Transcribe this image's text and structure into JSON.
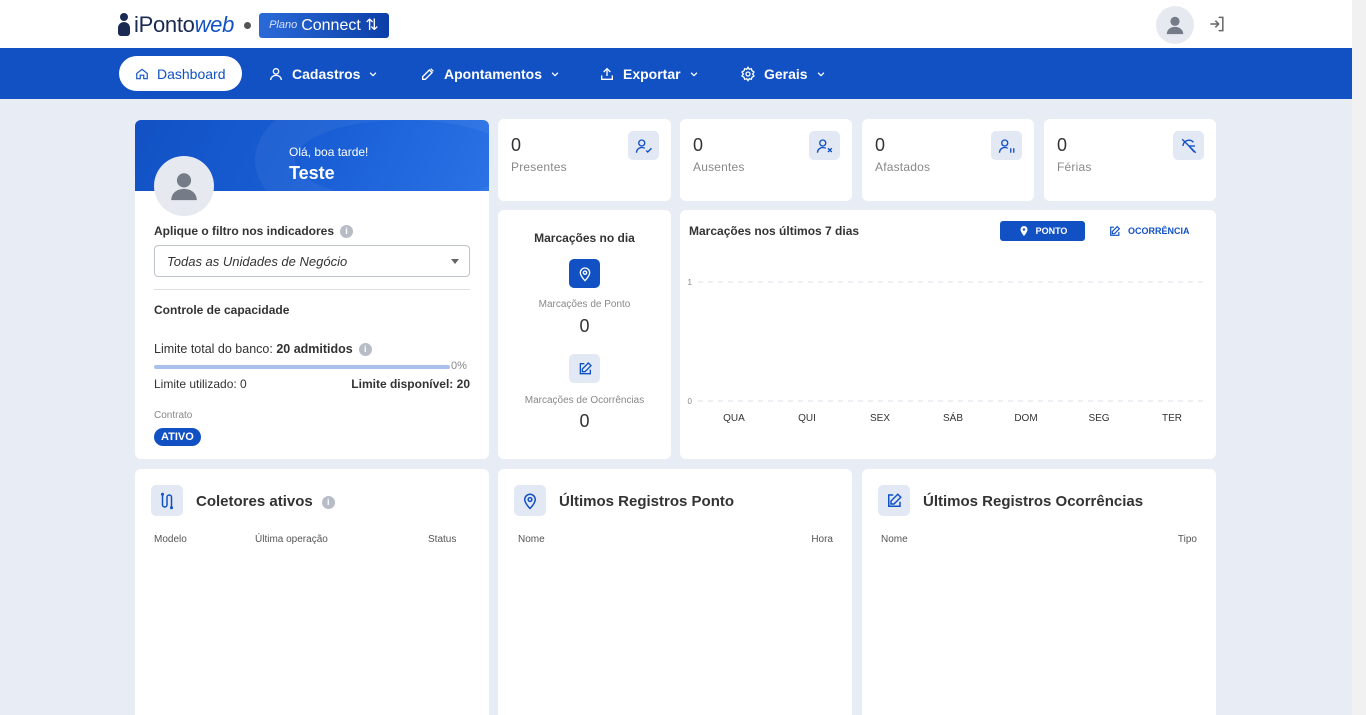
{
  "header": {
    "logo_main": "iPonto",
    "logo_web": "web",
    "plan_small": "Plano",
    "plan_main": "Connect ⇅",
    "icons": [
      "user-avatar-icon",
      "logout-icon"
    ]
  },
  "nav": {
    "items": [
      {
        "label": "Dashboard",
        "icon": "home-icon"
      },
      {
        "label": "Cadastros",
        "icon": "user-icon"
      },
      {
        "label": "Apontamentos",
        "icon": "tools-icon"
      },
      {
        "label": "Exportar",
        "icon": "upload-icon"
      },
      {
        "label": "Gerais",
        "icon": "gear-icon"
      }
    ]
  },
  "profile": {
    "greeting": "Olá, boa tarde!",
    "name": "Teste",
    "filter_label": "Aplique o filtro nos indicadores",
    "filter_value": "Todas as Unidades de Negócio",
    "capacity_title": "Controle de capacidade",
    "limit_total_label": "Limite total do banco:",
    "limit_total_value": "20 admitidos",
    "progress_percent": "0%",
    "progress_fraction": 0,
    "limit_used": "Limite utilizado: 0",
    "limit_available_label": "Limite disponível:",
    "limit_available_value": "20",
    "contract_label": "Contrato",
    "contract_status": "ATIVO"
  },
  "stats": [
    {
      "value": "0",
      "label": "Presentes",
      "icon": "user-check-icon"
    },
    {
      "value": "0",
      "label": "Ausentes",
      "icon": "user-x-icon"
    },
    {
      "value": "0",
      "label": "Afastados",
      "icon": "user-pause-icon"
    },
    {
      "value": "0",
      "label": "Férias",
      "icon": "umbrella-off-icon"
    }
  ],
  "marcacoes_dia": {
    "title": "Marcações no dia",
    "ponto_label": "Marcações de Ponto",
    "ponto_value": "0",
    "ocorrencias_label": "Marcações de Ocorrências",
    "ocorrencias_value": "0"
  },
  "chart_card": {
    "title": "Marcações nos últimos 7 dias",
    "btn_ponto": "PONTO",
    "btn_ocorrencia": "OCORRÊNCIA"
  },
  "chart_data": {
    "type": "line",
    "title": "Marcações nos últimos 7 dias",
    "categories": [
      "QUA",
      "QUI",
      "SEX",
      "SÁB",
      "DOM",
      "SEG",
      "TER"
    ],
    "series": [
      {
        "values": [
          0,
          0,
          0,
          0,
          0,
          0,
          0
        ]
      }
    ],
    "ylim": [
      0,
      1
    ],
    "yticks": [
      "0",
      "1"
    ],
    "grid": true
  },
  "coletores": {
    "title": "Coletores ativos",
    "columns": [
      "Modelo",
      "Última operação",
      "Status"
    ]
  },
  "registros_ponto": {
    "title": "Últimos Registros Ponto",
    "columns": [
      "Nome",
      "Hora"
    ]
  },
  "registros_ocorrencias": {
    "title": "Últimos Registros Ocorrências",
    "columns": [
      "Nome",
      "Tipo"
    ]
  },
  "colors": {
    "primary": "#1151c4",
    "background": "#e8ecf5",
    "icon_bg": "#e2e8f4"
  }
}
